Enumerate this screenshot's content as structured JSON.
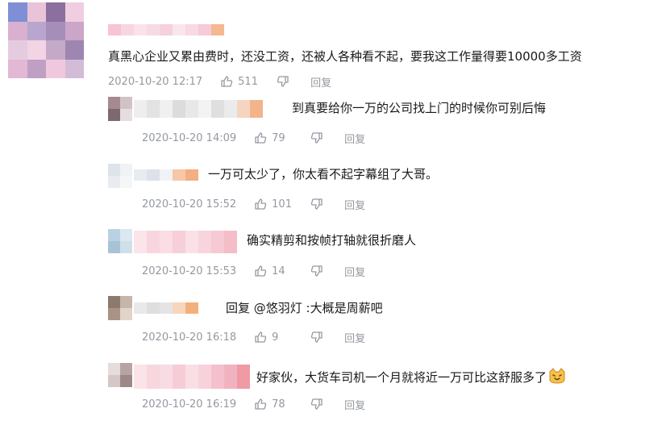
{
  "comments": [
    {
      "text": "真黑心企业又累由费时，还没工资，还被人各种看不起，要我这工作量得要10000多工资",
      "time": "2020-10-20 12:17",
      "likes": "511",
      "reply_label": "回复",
      "avatar_colors": [
        "#7f8fd6",
        "#e9c3d8",
        "#8b6f9e",
        "#f0cde0",
        "#d9b0cf",
        "#b8a6cf",
        "#a58fb8",
        "#cba6c9",
        "#e5cbe0",
        "#f3d4e4",
        "#c4aac8",
        "#9d86b0",
        "#e3b8d4",
        "#bfa0c4",
        "#f0c8dd",
        "#d2bcd8"
      ],
      "name_colors": [
        "#f6c4d4",
        "#f8d6e1",
        "#fbe2ea",
        "#f6dbe4",
        "#f5d0df",
        "#f8e6ec",
        "#f8d9e4",
        "#f7cad9",
        "#f5b88f"
      ]
    },
    {
      "text": "到真要给你一万的公司找上门的时候你可别后悔",
      "time": "2020-10-20 14:09",
      "likes": "79",
      "reply_label": "回复",
      "avatar_colors": [
        "#a58a8f",
        "#d1c2c6",
        "#7d6a70",
        "#e6dde0"
      ],
      "name_colors": [
        "#eeeeee",
        "#e3e3e3",
        "#f0f0f0",
        "#dcdcdc",
        "#e8e8e8",
        "#f3f3f3",
        "#dfdfdf",
        "#ebebeb",
        "#f6d4c2",
        "#f3b38b"
      ]
    },
    {
      "text": "一万可太少了，你太看不起字幕组了大哥。",
      "time": "2020-10-20 15:52",
      "likes": "101",
      "reply_label": "回复",
      "avatar_colors": [
        "#dfe3ea",
        "#f0f2f5",
        "#e8ebef",
        "#f5f6f8"
      ],
      "name_colors": [
        "#e8ecf2",
        "#dde2ea",
        "#f0f3f6",
        "#f7c7a8",
        "#f4ae83"
      ]
    },
    {
      "text": "确实精剪和按帧打轴就很折磨人",
      "time": "2020-10-20 15:53",
      "likes": "14",
      "reply_label": "回复",
      "avatar_colors": [
        "#b9d2e3",
        "#dbe8f0",
        "#a9c3d6",
        "#cfe0ea"
      ],
      "name_colors": [
        "#fbe5ea",
        "#f8d6df",
        "#fadde5",
        "#f7cfd9",
        "#fae0e7",
        "#f8d4dd",
        "#f6c9d4",
        "#f5bdc8"
      ]
    },
    {
      "text": "回复 @悠羽灯 :大概是周薪吧",
      "time": "2020-10-20 16:18",
      "likes": "9",
      "reply_label": "回复",
      "avatar_colors": [
        "#8c7a6e",
        "#c6b5a9",
        "#a99385",
        "#e0d4cb"
      ],
      "name_colors": [
        "#e9e9e9",
        "#dedede",
        "#e4e4e4",
        "#f7d6bc",
        "#f3b07b"
      ]
    },
    {
      "text": "好家伙，大货车司机一个月就将近一万可比这舒服多了",
      "time": "2020-10-20 16:19",
      "likes": "78",
      "reply_label": "回复",
      "avatar_colors": [
        "#e7dcdc",
        "#b8a3a3",
        "#d6c7c7",
        "#9e8787"
      ],
      "name_colors": [
        "#fbe3e8",
        "#f8d6de",
        "#f9dce3",
        "#f6cdd7",
        "#f9dfe5",
        "#f7d2db",
        "#f4c0cd",
        "#f2b3c0",
        "#ef9aa5"
      ]
    }
  ]
}
